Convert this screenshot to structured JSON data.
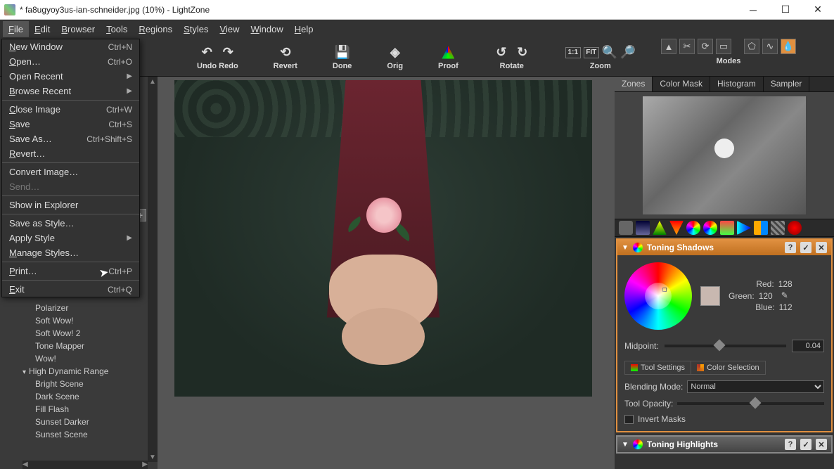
{
  "window": {
    "title": "* fa8ugyoy3us-ian-schneider.jpg (10%) - LightZone"
  },
  "menubar": [
    "File",
    "Edit",
    "Browser",
    "Tools",
    "Regions",
    "Styles",
    "View",
    "Window",
    "Help"
  ],
  "toolbar": {
    "undo_redo": "Undo Redo",
    "revert": "Revert",
    "done": "Done",
    "orig": "Orig",
    "proof": "Proof",
    "rotate": "Rotate",
    "zoom": "Zoom",
    "modes": "Modes",
    "zoom_fit": "FIT",
    "zoom_11": "1:1"
  },
  "file_menu": [
    {
      "label": "New Window",
      "shortcut": "Ctrl+N",
      "u": "N"
    },
    {
      "label": "Open…",
      "shortcut": "Ctrl+O",
      "u": "O"
    },
    {
      "label": "Open Recent",
      "sub": true,
      "u": ""
    },
    {
      "label": "Browse Recent",
      "sub": true,
      "u": "B"
    },
    {
      "sep": true
    },
    {
      "label": "Close Image",
      "shortcut": "Ctrl+W",
      "u": "C"
    },
    {
      "label": "Save",
      "shortcut": "Ctrl+S",
      "u": "S"
    },
    {
      "label": "Save As…",
      "shortcut": "Ctrl+Shift+S"
    },
    {
      "label": "Revert…",
      "u": "R"
    },
    {
      "sep": true
    },
    {
      "label": "Convert Image…"
    },
    {
      "label": "Send…",
      "disabled": true
    },
    {
      "sep": true
    },
    {
      "label": "Show in Explorer"
    },
    {
      "sep": true
    },
    {
      "label": "Save as Style…"
    },
    {
      "label": "Apply Style",
      "sub": true
    },
    {
      "label": "Manage Styles…",
      "u": "M"
    },
    {
      "sep": true
    },
    {
      "label": "Print…",
      "shortcut": "Ctrl+P",
      "u": "P"
    },
    {
      "sep": true
    },
    {
      "label": "Exit",
      "shortcut": "Ctrl+Q",
      "u": "E"
    }
  ],
  "styles_tree": {
    "items": [
      "Polarizer",
      "Soft Wow!",
      "Soft Wow! 2",
      "Tone Mapper",
      "Wow!"
    ],
    "group": "High Dynamic Range",
    "group_items": [
      "Bright Scene",
      "Dark Scene",
      "Fill Flash",
      "Sunset Darker",
      "Sunset Scene"
    ]
  },
  "right": {
    "tabs": [
      "Zones",
      "Color Mask",
      "Histogram",
      "Sampler"
    ],
    "toning_shadows": {
      "title": "Toning Shadows",
      "red_lbl": "Red:",
      "red": "128",
      "green_lbl": "Green:",
      "green": "120",
      "blue_lbl": "Blue:",
      "blue": "112",
      "midpoint_lbl": "Midpoint:",
      "midpoint_val": "0.04",
      "tool_settings": "Tool Settings",
      "color_selection": "Color Selection",
      "blend_lbl": "Blending Mode:",
      "blend_val": "Normal",
      "opacity_lbl": "Tool Opacity:",
      "invert_lbl": "Invert Masks"
    },
    "toning_highlights": {
      "title": "Toning Highlights"
    }
  }
}
